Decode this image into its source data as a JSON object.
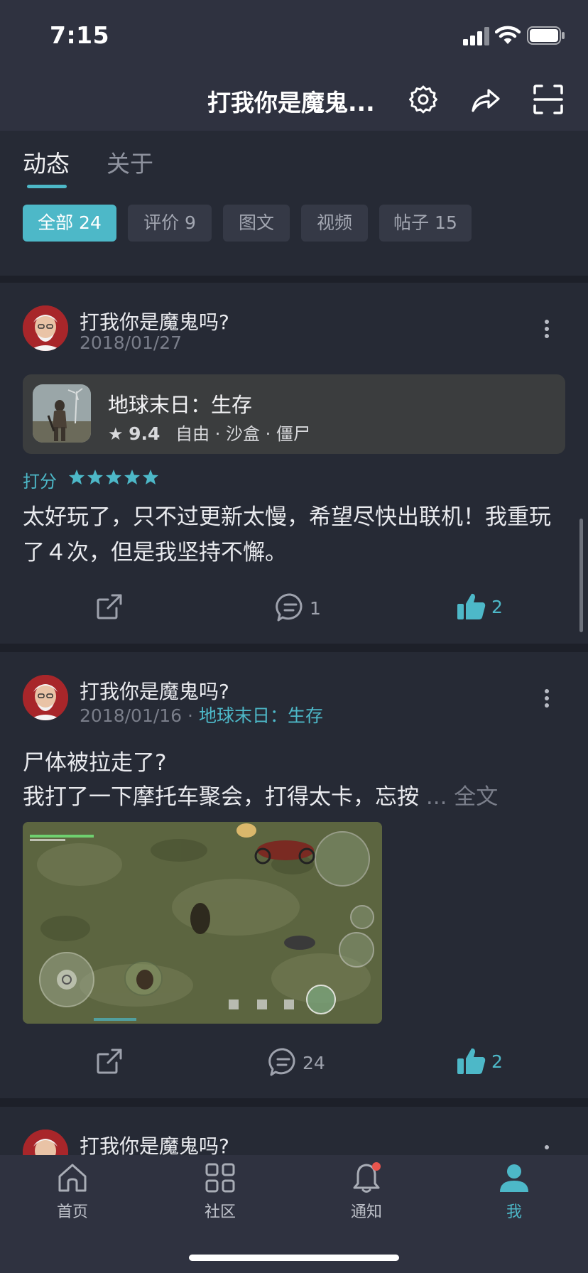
{
  "status_bar": {
    "time": "7:15"
  },
  "header": {
    "title": "打我你是魔鬼..."
  },
  "tabs": [
    {
      "label": "动态",
      "active": true
    },
    {
      "label": "关于",
      "active": false
    }
  ],
  "filters": [
    {
      "label": "全部 24",
      "active": true
    },
    {
      "label": "评价 9",
      "active": false
    },
    {
      "label": "图文",
      "active": false
    },
    {
      "label": "视频",
      "active": false
    },
    {
      "label": "帖子 15",
      "active": false
    }
  ],
  "posts": [
    {
      "username": "打我你是魔鬼吗?",
      "date": "2018/01/27",
      "game": {
        "title": "地球末日：生存",
        "score": "9.4",
        "tags": "自由 · 沙盒 · 僵尸"
      },
      "rating_label": "打分",
      "rating_stars": 5,
      "text": "太好玩了，只不过更新太慢，希望尽快出联机！我重玩了４次，但是我坚持不懈。",
      "comments": "1",
      "likes": "2"
    },
    {
      "username": "打我你是魔鬼吗?",
      "date": "2018/01/16",
      "separator": "·",
      "game_name": "地球末日：生存",
      "title": "尸体被拉走了?",
      "snippet": "我打了一下摩托车聚会，打得太卡，忘按",
      "more_label": "... 全文",
      "comments": "24",
      "likes": "2"
    },
    {
      "username": "打我你是魔鬼吗?"
    }
  ],
  "bottom_nav": [
    {
      "label": "首页",
      "icon": "home-icon",
      "active": false
    },
    {
      "label": "社区",
      "icon": "grid-icon",
      "active": false
    },
    {
      "label": "通知",
      "icon": "bell-icon",
      "active": false,
      "badge": true
    },
    {
      "label": "我",
      "icon": "person-icon",
      "active": true
    }
  ],
  "colors": {
    "accent": "#4db8c8",
    "background": "#1d2029",
    "card": "#262a35",
    "header": "#2f3240",
    "badge": "#e8554e"
  }
}
